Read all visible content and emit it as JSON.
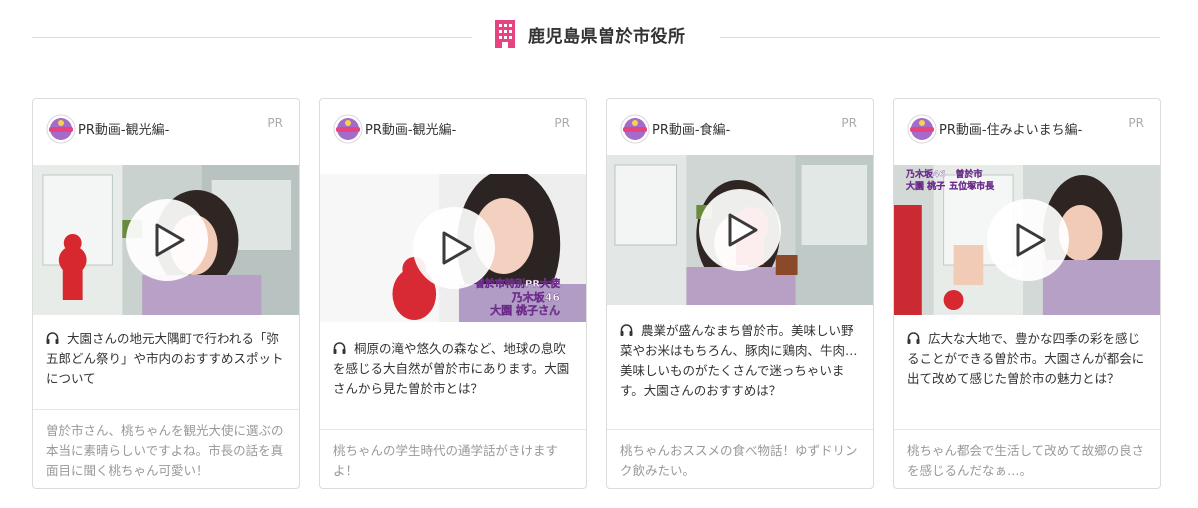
{
  "header": {
    "title": "鹿児島県曽於市役所",
    "icon": "building-icon",
    "accent": "#e4447f"
  },
  "cards": [
    {
      "label": "PR動画-観光編-",
      "pr": "PR",
      "caption": "大園さんの地元大隅町で行われる「弥五郎どん祭り」や市内のおすすめスポットについて",
      "comment": "曽於市さん、桃ちゃんを観光大使に選ぶの本当に素晴らしいですよね。市長の話を真面目に聞く桃ちゃん可愛い！"
    },
    {
      "label": "PR動画-観光編-",
      "pr": "PR",
      "caption": "桐原の滝や悠久の森など、地球の息吹を感じる大自然が曽於市にあります。大園さんから見た曽於市とは？",
      "comment": "桃ちゃんの学生時代の通学話がきけますよ！",
      "overlay": [
        "曽於市特別PR大使",
        "乃木坂46",
        "大園 桃子さん"
      ]
    },
    {
      "label": "PR動画-食編-",
      "pr": "PR",
      "caption": "農業が盛んなまち曽於市。美味しい野菜やお米はもちろん、豚肉に鶏肉、牛肉…美味しいものがたくさんで迷っちゃいます。大園さんのおすすめは？",
      "comment": "桃ちゃんおススメの食べ物話！ゆずドリンク飲みたい。"
    },
    {
      "label": "PR動画-住みよいまち編-",
      "pr": "PR",
      "caption": "広大な大地で、豊かな四季の彩を感じることができる曽於市。大園さんが都会に出て改めて感じた曽於市の魅力とは？",
      "comment": "桃ちゃん都会で生活して改めて故郷の良さを感じるんだなぁ…。",
      "overlay": [
        "乃木坂46",
        "曽於市",
        "大園 桃子",
        "五位塚市長"
      ]
    }
  ]
}
